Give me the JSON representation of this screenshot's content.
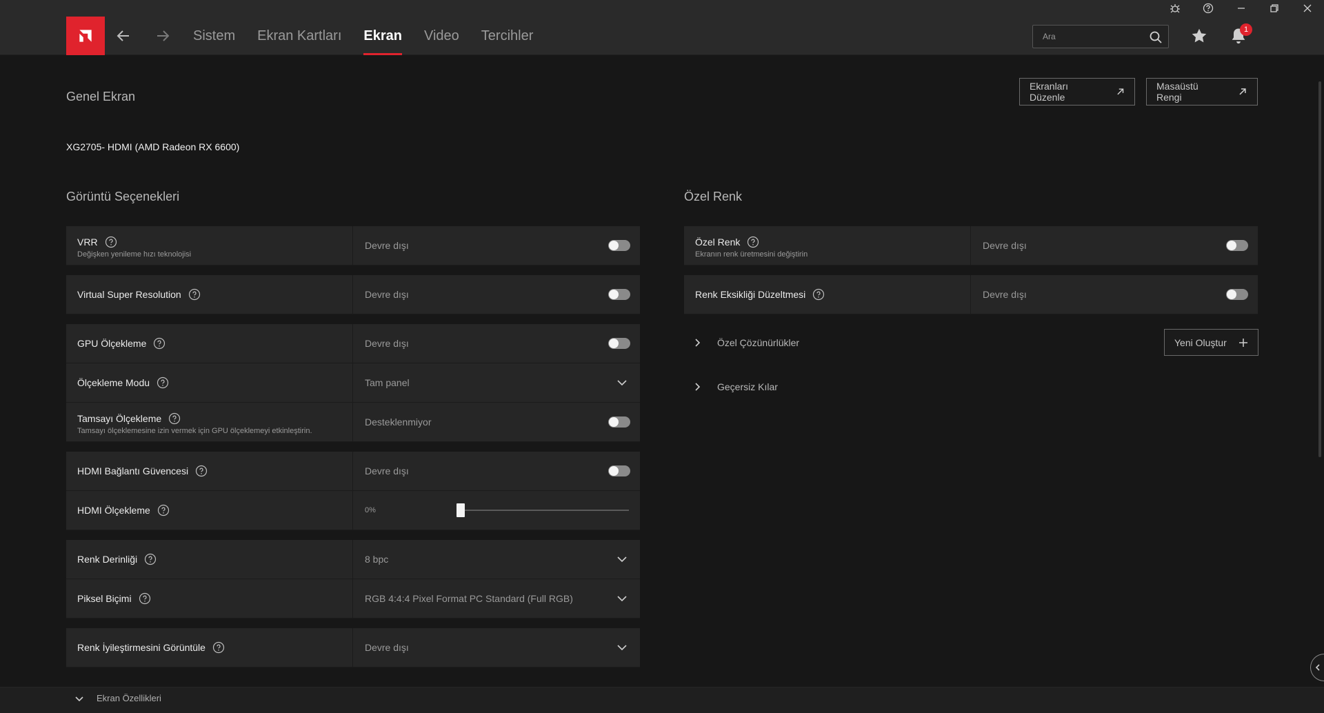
{
  "nav": {
    "tabs": [
      {
        "label": "Sistem"
      },
      {
        "label": "Ekran Kartları"
      },
      {
        "label": "Ekran"
      },
      {
        "label": "Video"
      },
      {
        "label": "Tercihler"
      }
    ],
    "search_placeholder": "Ara",
    "notification_count": "1"
  },
  "page": {
    "title": "Genel Ekran",
    "edit_displays_button": "Ekranları Düzenle",
    "desktop_color_button": "Masaüstü Rengi",
    "display_name": "XG2705- HDMI (AMD Radeon RX 6600)"
  },
  "display_options": {
    "title": "Görüntü Seçenekleri",
    "rows": [
      {
        "label": "VRR",
        "sub": "Değişken yenileme hızı teknolojisi",
        "value": "Devre dışı",
        "control": "toggle"
      },
      {
        "label": "Virtual Super Resolution",
        "value": "Devre dışı",
        "control": "toggle"
      },
      {
        "label": "GPU Ölçekleme",
        "value": "Devre dışı",
        "control": "toggle"
      },
      {
        "label": "Ölçekleme Modu",
        "value": "Tam panel",
        "control": "dropdown"
      },
      {
        "label": "Tamsayı Ölçekleme",
        "sub": "Tamsayı ölçeklemesine izin vermek için GPU ölçeklemeyi etkinleştirin.",
        "value": "Desteklenmiyor",
        "control": "toggle"
      },
      {
        "label": "HDMI Bağlantı Güvencesi",
        "value": "Devre dışı",
        "control": "toggle"
      },
      {
        "label": "HDMI Ölçekleme",
        "value": "0%",
        "control": "slider",
        "level": 0
      },
      {
        "label": "Renk Derinliği",
        "value": "8 bpc",
        "control": "dropdown"
      },
      {
        "label": "Piksel Biçimi",
        "value": "RGB 4:4:4 Pixel Format PC Standard (Full RGB)",
        "control": "dropdown"
      },
      {
        "label": "Renk İyileştirmesini Görüntüle",
        "value": "Devre dışı",
        "control": "dropdown"
      }
    ]
  },
  "custom_color": {
    "title": "Özel Renk",
    "rows": [
      {
        "label": "Özel Renk",
        "sub": "Ekranın renk üretmesini değiştirin",
        "value": "Devre dışı",
        "control": "toggle"
      },
      {
        "label": "Renk Eksikliği Düzeltmesi",
        "value": "Devre dışı",
        "control": "toggle"
      }
    ],
    "custom_resolutions": "Özel Çözünürlükler",
    "new_button": "Yeni Oluştur",
    "overrides": "Geçersiz Kılar"
  },
  "bottom": {
    "display_specs": "Ekran Özellikleri"
  },
  "colors": {
    "accent": "#e0232d",
    "background": "#171717",
    "panel": "#262626"
  }
}
